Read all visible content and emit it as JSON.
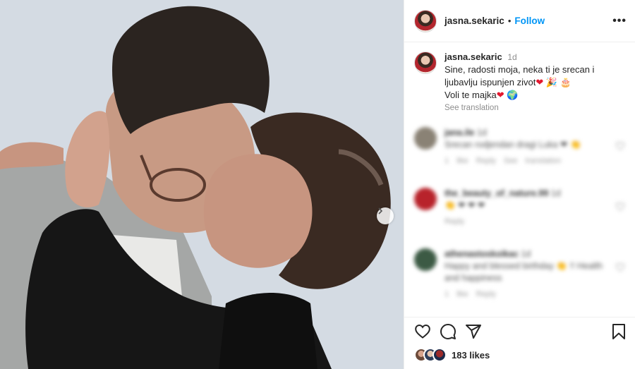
{
  "post": {
    "username": "jasna.sekaric",
    "follow_label": "Follow",
    "separator": "•",
    "more_label": "•••",
    "caption": {
      "username": "jasna.sekaric",
      "time": "1d",
      "line1": "Sine, radosti moja, neka ti je srecan i",
      "line2": "ljubavlju ispunjen zivot",
      "line3": "Voli te majka",
      "heart": "❤",
      "party": "🎉",
      "cake": "🎂",
      "globe": "🌍",
      "see_translation": "See translation"
    },
    "likes": "183 likes"
  },
  "comments": [
    {
      "user": "jana.ile",
      "time": "1d",
      "text": "Srecan rodjendan dragi Luka ❤ 👏",
      "meta": "1 like Reply See translation",
      "avatar_color": "#8a8275"
    },
    {
      "user": "the_beauty_of_nature.99",
      "time": "1d",
      "text": "👏 ❤ ❤ ❤",
      "meta": "Reply",
      "avatar_color": "#b8232b"
    },
    {
      "user": "athenastoskoikac",
      "time": "1d",
      "text": "Happy and blessed birthday 👏 !! Health and happiness",
      "meta": "1 like Reply",
      "avatar_color": "#3c5a44"
    }
  ],
  "colors": {
    "accent": "#0095f6",
    "heart": "#e3182f"
  }
}
